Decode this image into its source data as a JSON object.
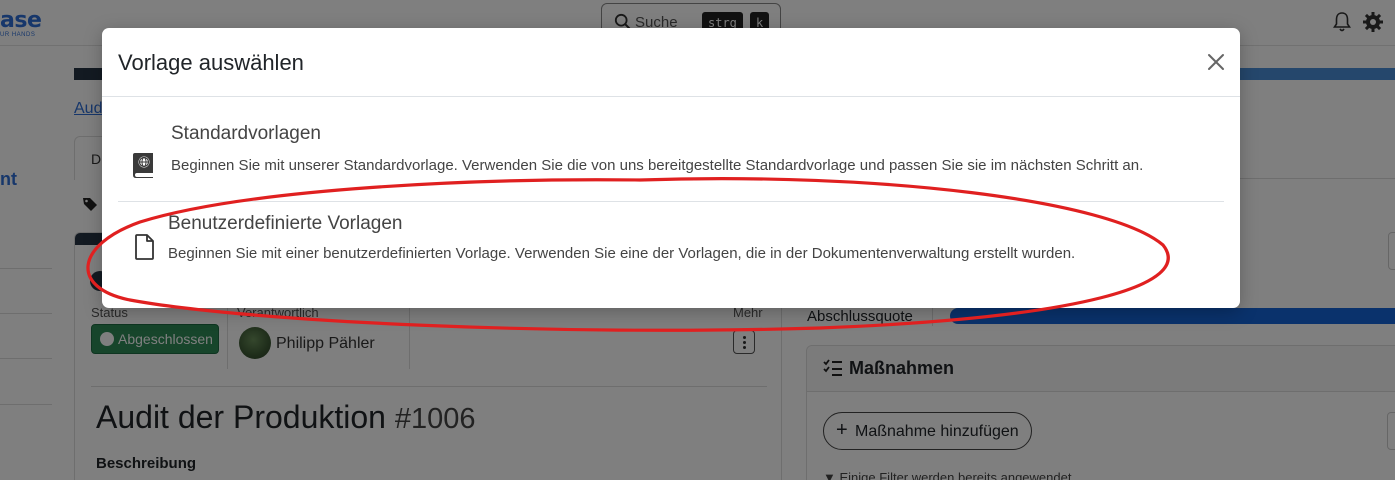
{
  "app": {
    "logo_text": "ase",
    "logo_tagline": "UR HANDS"
  },
  "header": {
    "search_placeholder": "Suche",
    "shortcut_key1": "strg",
    "shortcut_key2": "k"
  },
  "sidebar": {
    "partial_label": "nt"
  },
  "page": {
    "breadcrumb": "Aud",
    "tab_partial": "D",
    "status_label": "Status",
    "status_value": "Abgeschlossen",
    "responsible_label": "Verantwortlich",
    "responsible_name": "Philipp Pähler",
    "more_label": "Mehr",
    "title": "Audit der Produktion",
    "number": "#1006",
    "description_label": "Beschreibung"
  },
  "right_panel": {
    "completion_label": "Abschlussquote",
    "measures_title": "Maßnahmen",
    "add_measure_label": "Maßnahme hinzufügen",
    "filter_hint": "Einige Filter werden bereits angewendet"
  },
  "modal": {
    "title": "Vorlage auswählen",
    "options": [
      {
        "icon": "book-globe-icon",
        "title": "Standardvorlagen",
        "description": "Beginnen Sie mit unserer Standardvorlage. Verwenden Sie die von uns bereitgestellte Standardvorlage und passen Sie sie im nächsten Schritt an."
      },
      {
        "icon": "file-icon",
        "title": "Benutzerdefinierte Vorlagen",
        "description": "Beginnen Sie mit einer benutzerdefinierten Vorlage. Verwenden Sie eine der Vorlagen, die in der Dokumentenverwaltung erstellt wurden."
      }
    ]
  },
  "colors": {
    "accent_blue": "#2f6fd6",
    "status_green": "#2e8b57",
    "annotation_red": "#e02020",
    "dark_navy": "#273444"
  }
}
